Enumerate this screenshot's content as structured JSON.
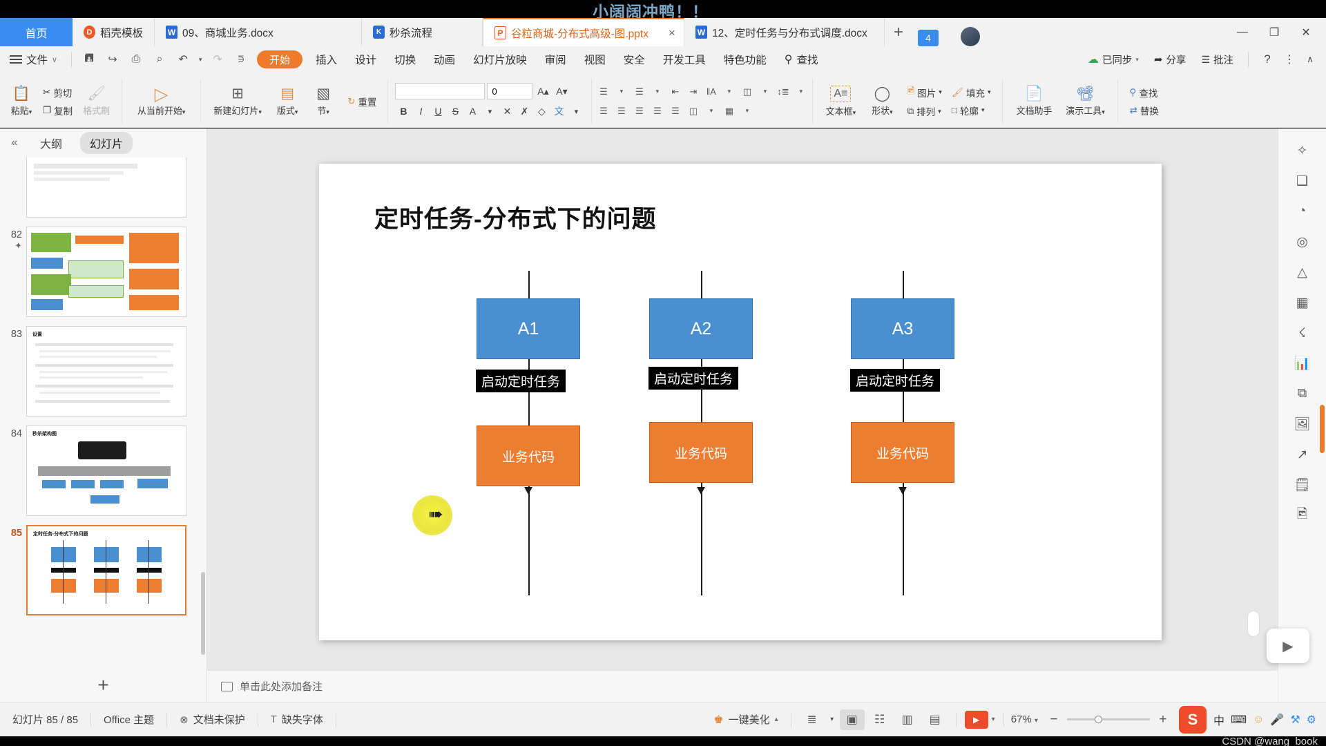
{
  "watermark": "小阔阔冲鸭！！",
  "tabbar": {
    "home_label": "首页",
    "tabs": [
      {
        "label": "稻壳模板",
        "icon": "dk-icon",
        "icon_kind": "dk",
        "icon_text": "●",
        "active": false,
        "closable": false
      },
      {
        "label": "09、商城业务.docx",
        "icon": "word-icon",
        "icon_kind": "w",
        "icon_text": "W",
        "active": false,
        "closable": false
      },
      {
        "label": "秒杀流程",
        "icon": "kspic-icon",
        "icon_kind": "ks",
        "icon_text": "⚙",
        "active": false,
        "closable": false
      },
      {
        "label": "谷粒商城-分布式高级-图.pptx",
        "icon": "powerpoint-icon",
        "icon_kind": "p",
        "icon_text": "P",
        "active": true,
        "closable": true
      },
      {
        "label": "12、定时任务与分布式调度.docx",
        "icon": "word-icon",
        "icon_kind": "w",
        "icon_text": "W",
        "active": false,
        "closable": false
      }
    ],
    "new_tab": "+",
    "tab_count": "4",
    "close_symbol": "×",
    "window_buttons": [
      "—",
      "❐",
      "✕"
    ]
  },
  "menubar": {
    "file_label": "文件",
    "file_caret": "∨",
    "quick_icons": [
      {
        "name": "save-icon",
        "glyph": "὚B"
      },
      {
        "name": "save-as-icon",
        "glyph": "↪"
      },
      {
        "name": "print-icon",
        "glyph": "⎙"
      },
      {
        "name": "print-preview-icon",
        "glyph": "⌕"
      },
      {
        "name": "undo-icon",
        "glyph": "↶"
      },
      {
        "name": "undo-caret-icon",
        "glyph": "▾"
      },
      {
        "name": "redo-icon",
        "glyph": "↷"
      },
      {
        "name": "customize-caret-icon",
        "glyph": "⌵"
      }
    ],
    "items": [
      {
        "label": "开始",
        "active": true
      },
      {
        "label": "插入",
        "active": false
      },
      {
        "label": "设计",
        "active": false
      },
      {
        "label": "切换",
        "active": false
      },
      {
        "label": "动画",
        "active": false
      },
      {
        "label": "幻灯片放映",
        "active": false
      },
      {
        "label": "审阅",
        "active": false
      },
      {
        "label": "视图",
        "active": false
      },
      {
        "label": "安全",
        "active": false
      },
      {
        "label": "开发工具",
        "active": false
      },
      {
        "label": "特色功能",
        "active": false
      }
    ],
    "search_label": "查找",
    "search_icon": "⚲",
    "right_items": [
      {
        "label": "已同步",
        "icon": "cloud-sync-icon",
        "glyph": "☁",
        "caret": "▾"
      },
      {
        "label": "分享",
        "icon": "share-icon",
        "glyph": "➦",
        "caret": ""
      },
      {
        "label": "批注",
        "icon": "comment-icon",
        "glyph": "☰",
        "caret": ""
      }
    ],
    "help_icon": "?",
    "more_icon": "⋮",
    "collapse_icon": "∧"
  },
  "ribbon": {
    "groups": [
      {
        "name": "clipboard",
        "main": {
          "label": "粘贴",
          "caret": "▾",
          "icon": "paste-icon",
          "glyph": "ὌB"
        },
        "small": [
          {
            "label": "剪切",
            "icon": "cut-icon",
            "glyph": "✂",
            "disabled": true
          },
          {
            "label": "复制",
            "icon": "copy-icon",
            "glyph": "❐",
            "disabled": true
          }
        ],
        "brush": {
          "label": "格式刷",
          "icon": "format-painter-icon",
          "glyph": "὘C",
          "disabled": true
        }
      },
      {
        "name": "slideshow",
        "buttons": [
          {
            "label": "从当前开始",
            "caret": "▾",
            "icon": "play-circle-icon",
            "glyph": "▷"
          }
        ]
      },
      {
        "name": "slides",
        "buttons": [
          {
            "label": "新建幻灯片",
            "caret": "▾",
            "icon": "new-slide-icon",
            "glyph": "⊞"
          },
          {
            "label": "版式",
            "caret": "▾",
            "icon": "layout-icon",
            "glyph": "▤"
          },
          {
            "label": "节",
            "caret": "▾",
            "icon": "section-icon",
            "glyph": "▧"
          }
        ],
        "reset": {
          "label": "重置",
          "icon": "reset-icon",
          "glyph": "↻"
        }
      },
      {
        "name": "font",
        "font_value": "",
        "font_placeholder": "",
        "size_value": "0",
        "grow_icon": "A▴",
        "shrink_icon": "A▾",
        "buttons": [
          {
            "label": "B",
            "name": "bold-button"
          },
          {
            "label": "I",
            "name": "italic-button"
          },
          {
            "label": "U",
            "name": "underline-button"
          },
          {
            "label": "S",
            "name": "strikethrough-button"
          },
          {
            "label": "A",
            "name": "text-color-button"
          },
          {
            "label": "✕",
            "name": "clear-format-button"
          },
          {
            "label": "✗",
            "name": "char-spacing-button"
          },
          {
            "label": "◇",
            "name": "highlight-button"
          },
          {
            "label": "文",
            "name": "text-effect-button"
          }
        ]
      },
      {
        "name": "paragraph",
        "row1": [
          "≡",
          "≡",
          "≡",
          "≡",
          "≣",
          "≣"
        ],
        "row2": [
          "☰",
          "☰",
          "☷",
          "☷",
          "≡",
          "≣"
        ]
      },
      {
        "name": "text-direction",
        "buttons": [
          {
            "label": "",
            "icon": "text-direction-icon",
            "glyph": "↕"
          },
          {
            "label": "",
            "icon": "align-text-icon",
            "glyph": "≣"
          },
          {
            "label": "",
            "icon": "columns-icon",
            "glyph": "‖"
          }
        ]
      },
      {
        "name": "insert",
        "buttons": [
          {
            "label": "文本框",
            "caret": "▾",
            "icon": "textbox-icon",
            "glyph": "A"
          },
          {
            "label": "形状",
            "caret": "▾",
            "icon": "shapes-icon",
            "glyph": "◯"
          },
          {
            "label": "图片",
            "caret": "▾",
            "icon": "picture-icon",
            "glyph": "ὛB"
          },
          {
            "label": "排列",
            "caret": "▾",
            "icon": "arrange-icon",
            "glyph": "⧉"
          },
          {
            "label": "填充",
            "caret": "▾",
            "icon": "fill-icon",
            "glyph": "὘C"
          },
          {
            "label": "轮廓",
            "caret": "▾",
            "icon": "outline-icon",
            "glyph": "□"
          }
        ]
      },
      {
        "name": "tools",
        "buttons": [
          {
            "label": "文档助手",
            "caret": "",
            "icon": "doc-assistant-icon",
            "glyph": "Ὄ4"
          },
          {
            "label": "演示工具",
            "caret": "▾",
            "icon": "present-tools-icon",
            "glyph": "὏D"
          }
        ]
      },
      {
        "name": "find",
        "buttons": [
          {
            "label": "查找",
            "icon": "find-icon",
            "glyph": "⚲"
          },
          {
            "label": "替换",
            "icon": "replace-icon",
            "glyph": "⇄"
          }
        ]
      }
    ]
  },
  "left_panel": {
    "collapse_icon": "«",
    "tabs": [
      {
        "label": "大纲",
        "active": false
      },
      {
        "label": "幻灯片",
        "active": true
      }
    ],
    "thumbnails": [
      {
        "number": "",
        "starred": false,
        "title": "",
        "kind": "code"
      },
      {
        "number": "82",
        "starred": true,
        "title": "",
        "kind": "diagram"
      },
      {
        "number": "83",
        "starred": false,
        "title": "设置",
        "kind": "text"
      },
      {
        "number": "84",
        "starred": false,
        "title": "秒杀架构图",
        "kind": "arch"
      },
      {
        "number": "85",
        "starred": false,
        "title": "定时任务-分布式下的问题",
        "kind": "current",
        "selected": true
      }
    ],
    "add_label": "+"
  },
  "slide": {
    "title": "定时任务-分布式下的问题",
    "columns": [
      {
        "node": "A1",
        "tag": "启动定时任务",
        "code": "业务代码"
      },
      {
        "node": "A2",
        "tag": "启动定时任务",
        "code": "业务代码"
      },
      {
        "node": "A3",
        "tag": "启动定时任务",
        "code": "业务代码"
      }
    ],
    "colors": {
      "node_blue": "#4a8fd0",
      "node_orange": "#ed7d31",
      "tag_black": "#000000"
    }
  },
  "notes": {
    "placeholder": "单击此处添加备注",
    "icon": "notes-icon"
  },
  "right_sidebar": {
    "icons": [
      {
        "name": "sparkle-icon",
        "glyph": "✧"
      },
      {
        "name": "grid-frame-icon",
        "glyph": "❑"
      },
      {
        "name": "shapes-panel-icon",
        "glyph": "◔"
      },
      {
        "name": "target-icon",
        "glyph": "◎"
      },
      {
        "name": "triangle-icon",
        "glyph": "△"
      },
      {
        "name": "table-icon",
        "glyph": "▦"
      },
      {
        "name": "apps-icon",
        "glyph": "⚇"
      },
      {
        "name": "chart-icon",
        "glyph": "ὌA"
      },
      {
        "name": "flow-icon",
        "glyph": "⧉"
      },
      {
        "name": "image-panel-icon",
        "glyph": "ὛC"
      },
      {
        "name": "export-icon",
        "glyph": "↗"
      },
      {
        "name": "notes-panel-icon",
        "glyph": "Ὕ2"
      },
      {
        "name": "media-icon",
        "glyph": "ὛB"
      },
      {
        "name": "more-panel-icon",
        "glyph": "⋯"
      }
    ],
    "play_icon": "▶"
  },
  "statusbar": {
    "slide_count": "幻灯片 85 / 85",
    "theme": "Office 主题",
    "protection": "文档未保护",
    "protection_icon": "⊗",
    "font_missing": "缺失字体",
    "font_missing_icon": "T",
    "beautify": "一键美化",
    "beautify_caret": "▴",
    "beautify_icon": "ὅ1",
    "view_buttons": [
      {
        "name": "view-normal",
        "glyph": "≣",
        "active": false,
        "caret": "▾"
      },
      {
        "name": "view-reading",
        "glyph": "▣",
        "active": true,
        "caret": ""
      },
      {
        "name": "view-sorter",
        "glyph": "☷",
        "active": false,
        "caret": ""
      },
      {
        "name": "view-notes",
        "glyph": "▥",
        "active": false,
        "caret": ""
      },
      {
        "name": "view-outline",
        "glyph": "▤",
        "active": false,
        "caret": ""
      }
    ],
    "play_caret": "▾",
    "zoom": "67%",
    "zoom_caret": "▾",
    "zoom_minus": "−",
    "zoom_plus": "+",
    "wps_logo": "S",
    "tray": [
      {
        "name": "ime-icon",
        "glyph": "中"
      },
      {
        "name": "keyboard-icon",
        "glyph": "⌨"
      },
      {
        "name": "emoji-icon",
        "glyph": "☺"
      },
      {
        "name": "mic-icon",
        "glyph": "Ἲ4"
      },
      {
        "name": "tools-icon",
        "glyph": "⚒"
      },
      {
        "name": "settings-icon",
        "glyph": "⚙"
      }
    ]
  },
  "footer_credit": "CSDN @wang_book"
}
